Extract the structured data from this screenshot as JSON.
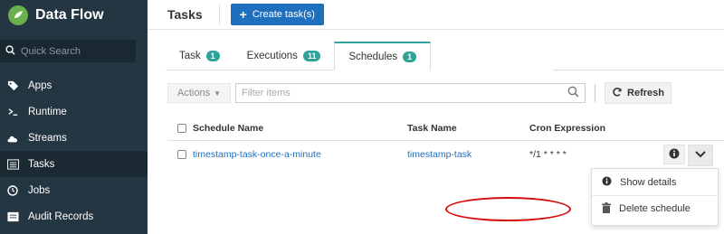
{
  "app": {
    "title": "Data Flow"
  },
  "sidebar": {
    "search_placeholder": "Quick Search",
    "items": [
      {
        "label": "Apps",
        "icon": "tag-icon"
      },
      {
        "label": "Runtime",
        "icon": "terminal-icon"
      },
      {
        "label": "Streams",
        "icon": "cloud-icon"
      },
      {
        "label": "Tasks",
        "icon": "tasks-icon",
        "active": true
      },
      {
        "label": "Jobs",
        "icon": "clock-icon"
      },
      {
        "label": "Audit Records",
        "icon": "list-icon"
      }
    ]
  },
  "header": {
    "title": "Tasks",
    "create_label": "Create task(s)"
  },
  "tabs": [
    {
      "label": "Task",
      "count": "1"
    },
    {
      "label": "Executions",
      "count": "11"
    },
    {
      "label": "Schedules",
      "count": "1",
      "active": true
    }
  ],
  "toolbar": {
    "actions_label": "Actions",
    "filter_placeholder": "Filter items",
    "refresh_label": "Refresh"
  },
  "table": {
    "headers": {
      "name": "Schedule Name",
      "task": "Task Name",
      "cron": "Cron Expression"
    },
    "rows": [
      {
        "name": "timestamp-task-once-a-minute",
        "task": "timestamp-task",
        "cron": "*/1 * * * *"
      }
    ]
  },
  "dropdown": {
    "items": [
      {
        "label": "Show details",
        "icon": "info-icon"
      },
      {
        "label": "Delete schedule",
        "icon": "trash-icon"
      }
    ]
  },
  "colors": {
    "sidebar_bg": "#243642",
    "primary": "#1f6fbf",
    "badge": "#2fa39a",
    "highlight": "#d60b0b"
  }
}
